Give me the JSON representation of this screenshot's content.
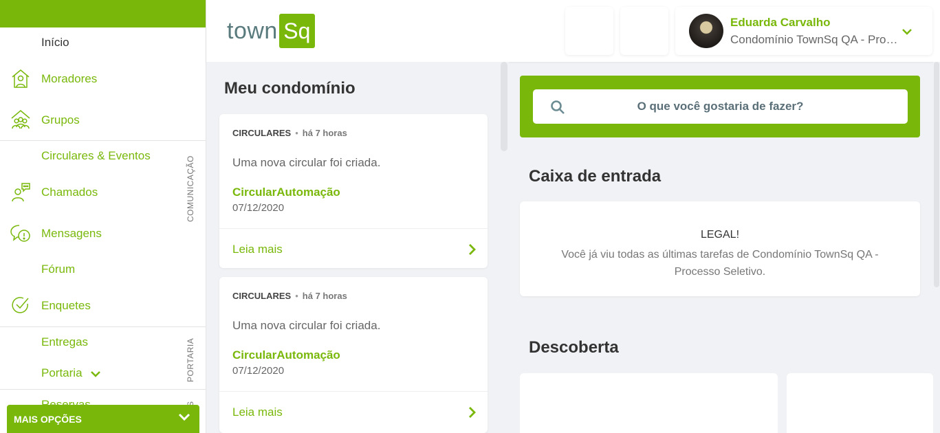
{
  "sidebar": {
    "items": [
      {
        "label": "Início",
        "icon": "home-icon"
      },
      {
        "label": "Moradores",
        "icon": "residents-icon"
      },
      {
        "label": "Grupos",
        "icon": "groups-icon"
      },
      {
        "label": "Circulares & Eventos",
        "icon": ""
      },
      {
        "label": "Chamados",
        "icon": "support-agent-icon"
      },
      {
        "label": "Mensagens",
        "icon": "message-icon"
      },
      {
        "label": "Fórum",
        "icon": ""
      },
      {
        "label": "Enquetes",
        "icon": "check-circle-icon"
      },
      {
        "label": "Entregas",
        "icon": ""
      },
      {
        "label": "Portaria",
        "icon": "chevron-down-icon"
      },
      {
        "label": "Reservas",
        "icon": "chevron-down-icon"
      }
    ],
    "section_comunicacao": "COMUNICAÇÃO",
    "section_portaria": "PORTARIA",
    "section_reservas_partial": "S",
    "more_options": "MAIS OPÇÕES"
  },
  "header": {
    "logo_town": "town",
    "logo_sq": "Sq",
    "user_name": "Eduarda Carvalho",
    "user_condo": "Condomínio TownSq QA - Processo Seletivo"
  },
  "main": {
    "title": "Meu condomínio",
    "cards": [
      {
        "category": "CIRCULARES",
        "time": "há 7 horas",
        "desc": "Uma nova circular foi criada.",
        "title": "CircularAutomação",
        "date": "07/12/2020",
        "more": "Leia mais"
      },
      {
        "category": "CIRCULARES",
        "time": "há 7 horas",
        "desc": "Uma nova circular foi criada.",
        "title": "CircularAutomação",
        "date": "07/12/2020",
        "more": "Leia mais"
      }
    ]
  },
  "right": {
    "search_placeholder": "O que você gostaria de fazer?",
    "inbox_title": "Caixa de entrada",
    "inbox_heading": "LEGAL!",
    "inbox_message": "Você já viu todas as últimas tarefas de Condomínio TownSq QA - Processo Seletivo.",
    "discover_title": "Descoberta"
  },
  "colors": {
    "brand": "#79b80b",
    "logo_text": "#5a7b7d"
  }
}
